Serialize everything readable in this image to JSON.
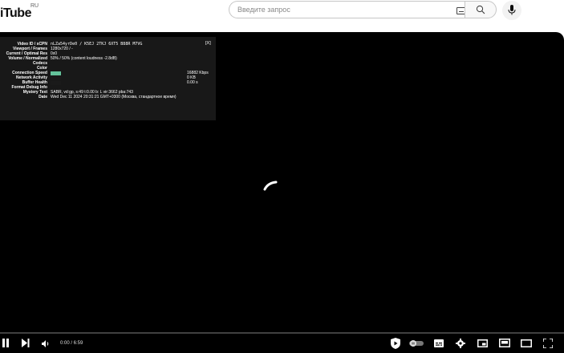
{
  "header": {
    "logo_text": "iTube",
    "logo_region": "RU",
    "search_placeholder": "Введите запрос"
  },
  "stats_overlay": {
    "close_label": "[X]",
    "rows": [
      {
        "label": "Video ID / sCPN",
        "value": "nLZa54yrDe0 / K5EJ 2TKJ 6XT5 B88R M7VG",
        "extra": ""
      },
      {
        "label": "Viewport / Frames",
        "value": "1280x720 / -",
        "extra": ""
      },
      {
        "label": "Current / Optimal Res",
        "value": "0x0",
        "extra": ""
      },
      {
        "label": "Volume / Normalized",
        "value": "50% / 50% (content loudness -2.8dB)",
        "extra": ""
      },
      {
        "label": "Codecs",
        "value": "",
        "extra": ""
      },
      {
        "label": "Color",
        "value": "",
        "extra": ""
      },
      {
        "label": "Connection Speed",
        "value": "",
        "extra": "16882 Kbps"
      },
      {
        "label": "Network Activity",
        "value": "",
        "extra": "0 KB"
      },
      {
        "label": "Buffer Health",
        "value": "",
        "extra": "0.00 s"
      },
      {
        "label": "Format Debug Info",
        "value": "",
        "extra": ""
      },
      {
        "label": "Mystery Text",
        "value": "SABR, vd:gp, s:49 t:0.00 b: L vir:3662 pba:743",
        "extra": ""
      },
      {
        "label": "Date",
        "value": "Wed Dec 11 2024 20:31:21 GMT+0300 (Москва, стандартное время)",
        "extra": ""
      }
    ],
    "connection_bar_color": "#64c39b",
    "network_bar_color": "#1a1a1a",
    "buffer_bar_color": "#1a1a1a"
  },
  "player": {
    "time_display": "0:00 / 6:59",
    "background_color": "#000000"
  },
  "icons": {
    "pause": "pause-icon",
    "next": "next-icon",
    "volume": "volume-icon",
    "shield": "shield-play-icon",
    "autoplay": "autoplay-toggle",
    "subtitles": "subtitles-icon",
    "settings": "gear-icon",
    "miniplayer": "miniplayer-icon",
    "theater": "theater-mode-icon",
    "cinema": "cinema-mode-icon",
    "fullscreen": "fullscreen-icon"
  }
}
